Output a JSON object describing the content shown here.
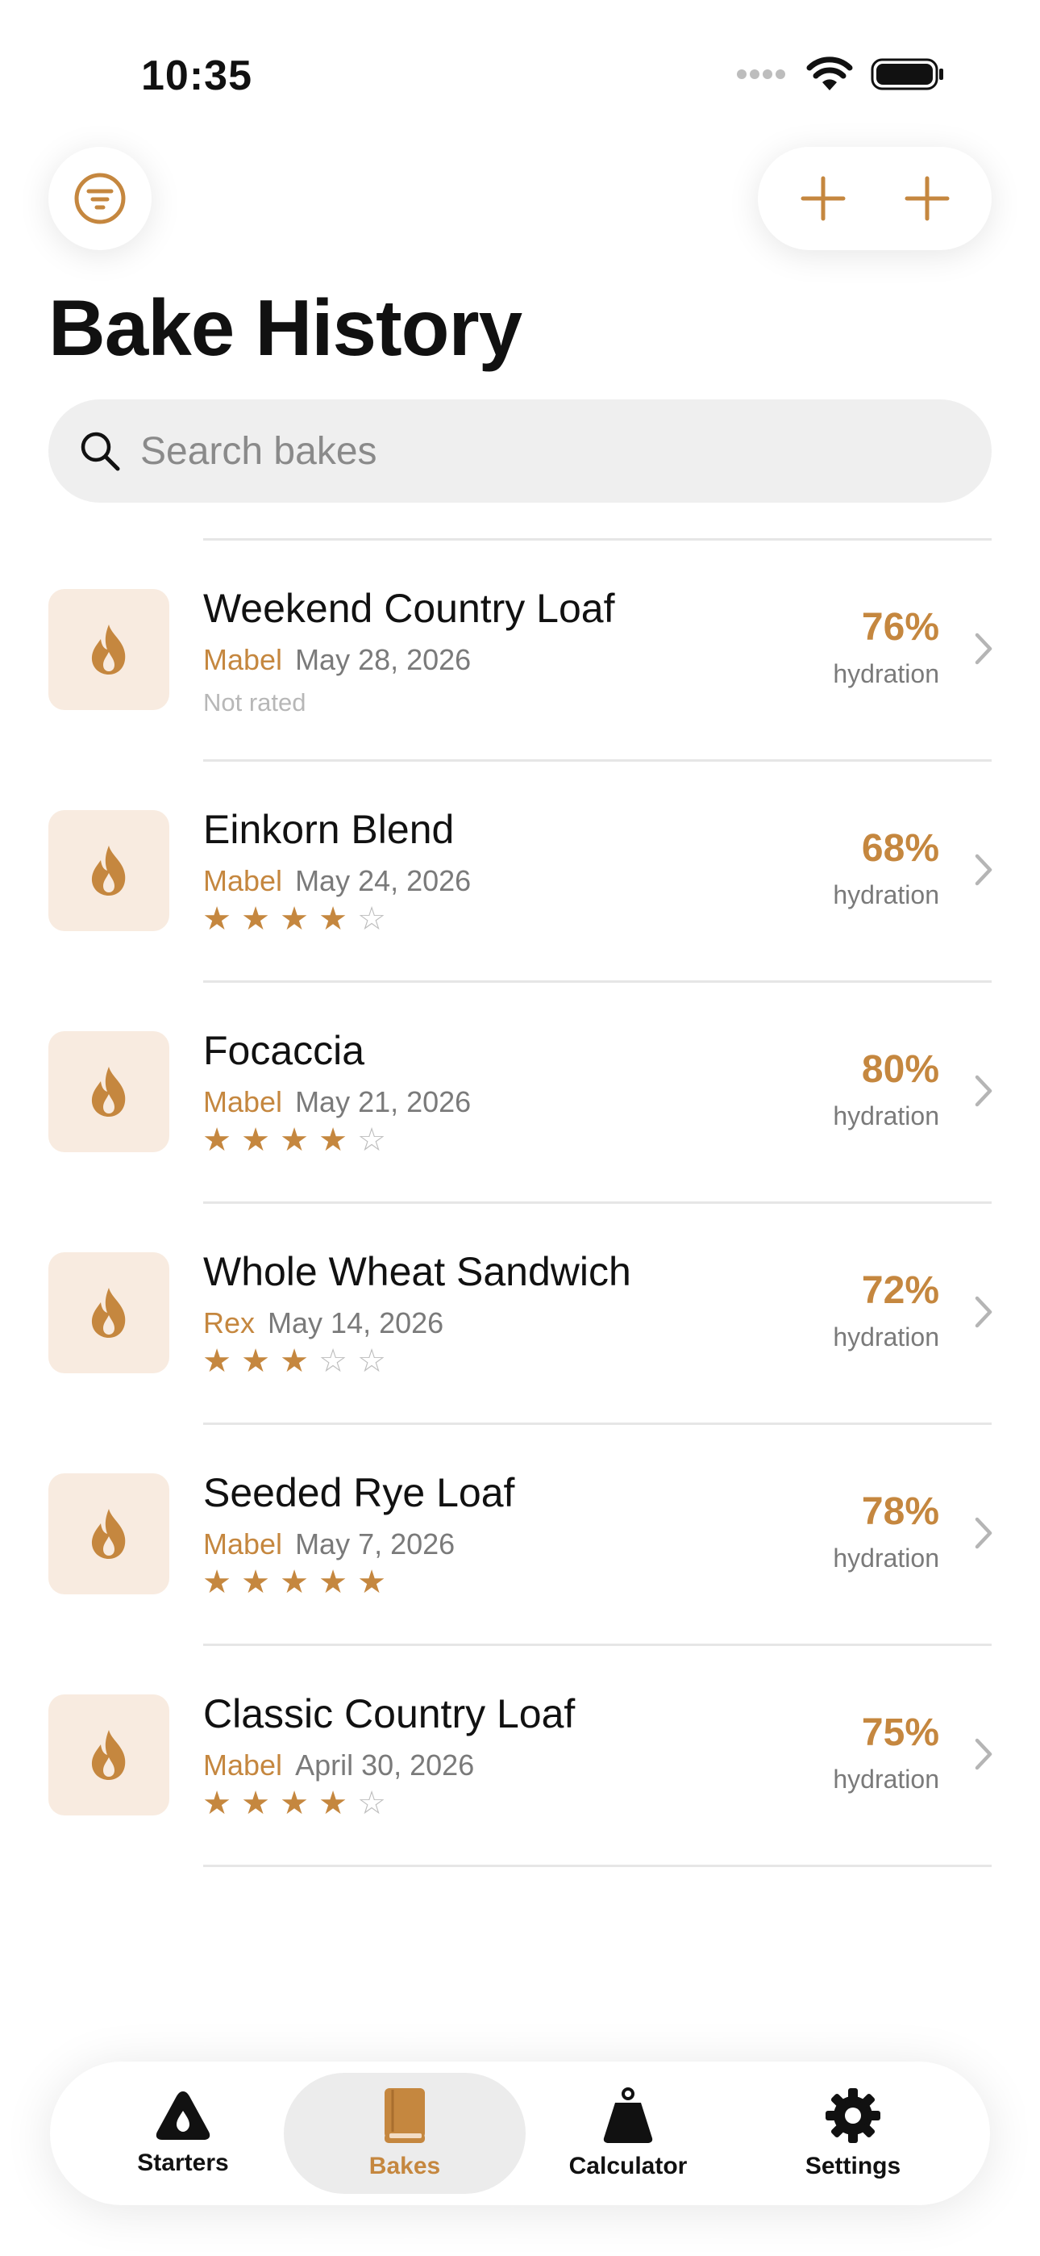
{
  "status_bar": {
    "time": "10:35"
  },
  "header": {
    "title": "Bake History"
  },
  "search": {
    "placeholder": "Search bakes"
  },
  "colors": {
    "accent": "#c5873f",
    "thumb_bg": "#f8ebe0"
  },
  "bakes": [
    {
      "name": "Weekend Country Loaf",
      "baker": "Mabel",
      "date": "May 28, 2026",
      "rating_text": "Not rated",
      "rating": 0,
      "hydration": "76%",
      "hydration_label": "hydration"
    },
    {
      "name": "Einkorn Blend",
      "baker": "Mabel",
      "date": "May 24, 2026",
      "rating": 4,
      "hydration": "68%",
      "hydration_label": "hydration"
    },
    {
      "name": "Focaccia",
      "baker": "Mabel",
      "date": "May 21, 2026",
      "rating": 4,
      "hydration": "80%",
      "hydration_label": "hydration"
    },
    {
      "name": "Whole Wheat Sandwich",
      "baker": "Rex",
      "date": "May 14, 2026",
      "rating": 3,
      "hydration": "72%",
      "hydration_label": "hydration"
    },
    {
      "name": "Seeded Rye Loaf",
      "baker": "Mabel",
      "date": "May 7, 2026",
      "rating": 5,
      "hydration": "78%",
      "hydration_label": "hydration"
    },
    {
      "name": "Classic Country Loaf",
      "baker": "Mabel",
      "date": "April 30, 2026",
      "rating": 4,
      "hydration": "75%",
      "hydration_label": "hydration"
    }
  ],
  "tabs": [
    {
      "label": "Starters",
      "icon": "drop-icon",
      "active": false
    },
    {
      "label": "Bakes",
      "icon": "book-icon",
      "active": true
    },
    {
      "label": "Calculator",
      "icon": "weight-icon",
      "active": false
    },
    {
      "label": "Settings",
      "icon": "gear-icon",
      "active": false
    }
  ]
}
